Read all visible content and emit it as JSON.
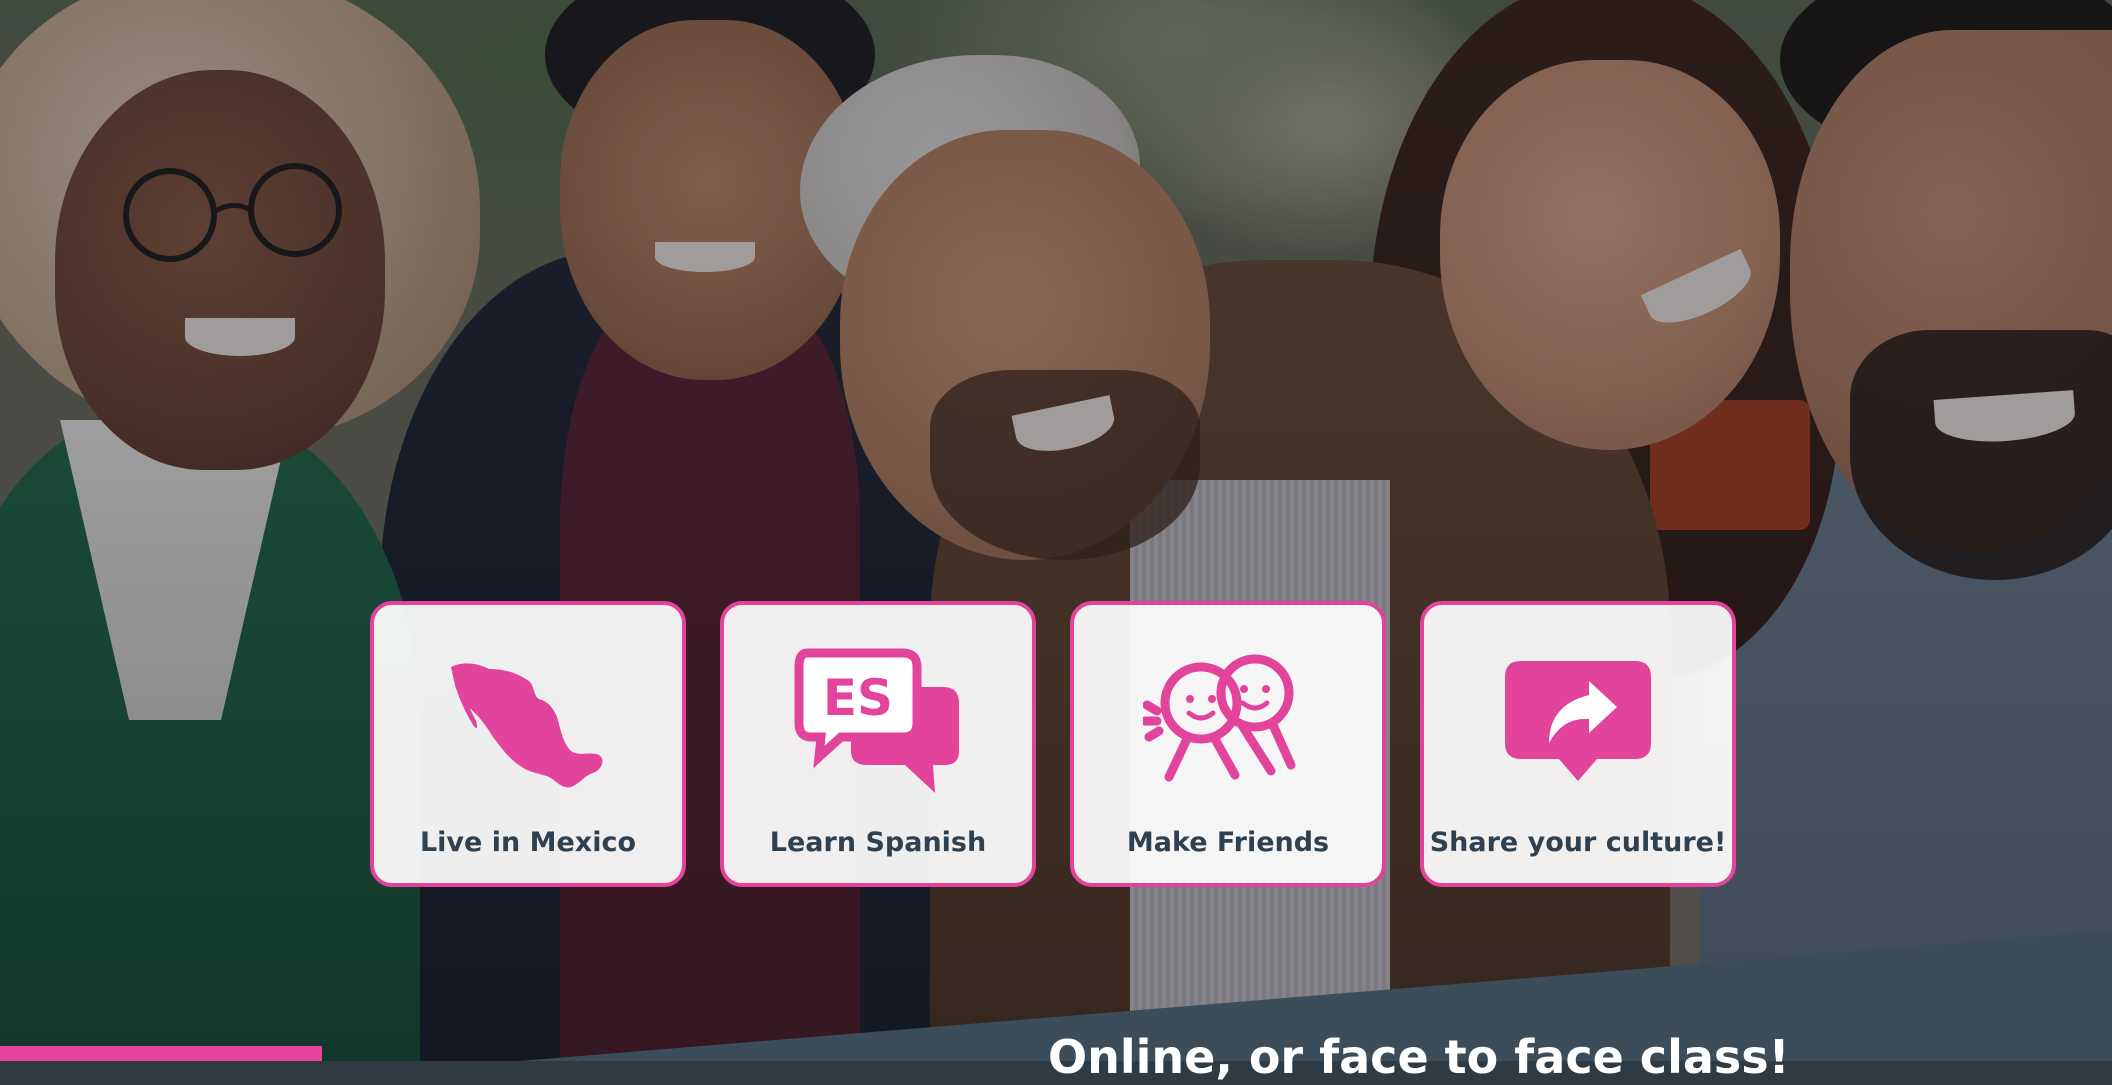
{
  "hero": {
    "photo": "group of five smiling young people outdoors"
  },
  "features": [
    {
      "label": "Live in Mexico",
      "icon": "mexico-map-icon"
    },
    {
      "label": "Learn Spanish",
      "icon": "es-speech-bubbles-icon",
      "icon_text": "ES"
    },
    {
      "label": "Make Friends",
      "icon": "two-smiling-people-icon"
    },
    {
      "label": "Share your culture!",
      "icon": "share-arrow-bubble-icon"
    }
  ],
  "band": {
    "title": "Online, or face to face class!"
  },
  "colors": {
    "accent": "#E3449B",
    "card_text": "#2F4050",
    "band": "#3B4D5B"
  }
}
